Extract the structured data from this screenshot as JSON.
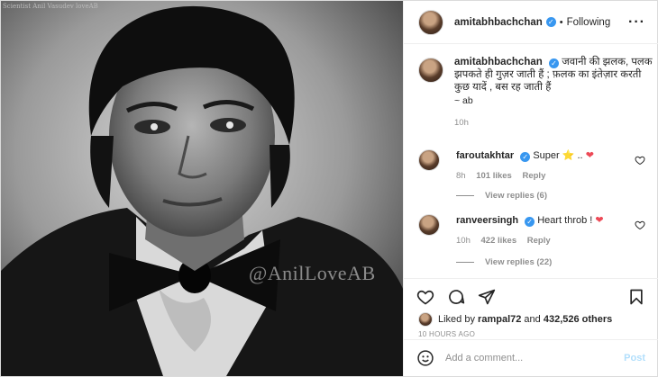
{
  "photo": {
    "watermark_top": "Scientist Anil Vasudev loveAB",
    "watermark_side": "@AnilLoveAB"
  },
  "header": {
    "username": "amitabhbachchan",
    "follow_label": "Following",
    "separator": "•",
    "more_icon": "more-horizontal-icon"
  },
  "caption": {
    "username": "amitabhbachchan",
    "text": "जवानी की झलक, पलक झपकते ही गुज़र जाती हैं ; फ़लक का इंतेज़ार करती कुछ यादें , बस रह जाती हैं",
    "signature": "~ ab",
    "time": "10h"
  },
  "comments": [
    {
      "username": "faroutakhtar",
      "text": "Super",
      "emoji_star": "⭐",
      "dots": "..",
      "emoji_heart": "❤",
      "time": "8h",
      "likes": "101 likes",
      "reply_label": "Reply",
      "view_replies": "View replies (6)"
    },
    {
      "username": "ranveersingh",
      "text": "Heart throb !",
      "emoji_heart": "❤",
      "time": "10h",
      "likes": "422 likes",
      "reply_label": "Reply",
      "view_replies": "View replies (22)"
    }
  ],
  "likes": {
    "prefix": "Liked by",
    "user": "rampal72",
    "conj": "and",
    "count": "432,526 others"
  },
  "post_time": "10 HOURS AGO",
  "composer": {
    "placeholder": "Add a comment...",
    "post_label": "Post"
  },
  "colors": {
    "verified": "#3897f0",
    "heart": "#ed4956",
    "post_button": "#b2dffc"
  }
}
